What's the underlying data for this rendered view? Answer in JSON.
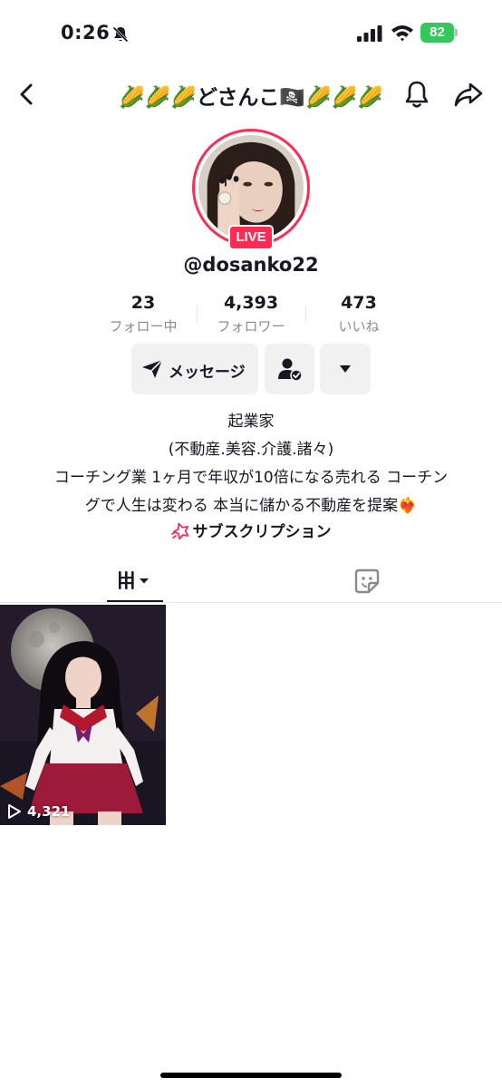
{
  "status_bar": {
    "time": "0:26",
    "battery": "82"
  },
  "nav": {
    "title": "🌽🌽🌽どさんこ🏴‍☠️🌽🌽🌽"
  },
  "profile": {
    "live_label": "LIVE",
    "username": "@dosanko22",
    "stats": [
      {
        "value": "23",
        "label": "フォロー中"
      },
      {
        "value": "4,393",
        "label": "フォロワー"
      },
      {
        "value": "473",
        "label": "いいね"
      }
    ],
    "message_label": "メッセージ",
    "bio_lines": [
      "起業家",
      "(不動産.美容.介護.諸々)",
      "コーチング業 1ヶ月で年収が10倍になる売れる コーチン",
      "グで人生は変わる 本当に儲かる不動産を提案❤️‍🔥"
    ],
    "subscription_label": "サブスクリプション"
  },
  "videos": [
    {
      "views": "4,321"
    }
  ],
  "colors": {
    "accent": "#fe2c55",
    "battery": "#34c759",
    "button_bg": "#f1f1f2",
    "secondary_text": "#8a8b91"
  }
}
